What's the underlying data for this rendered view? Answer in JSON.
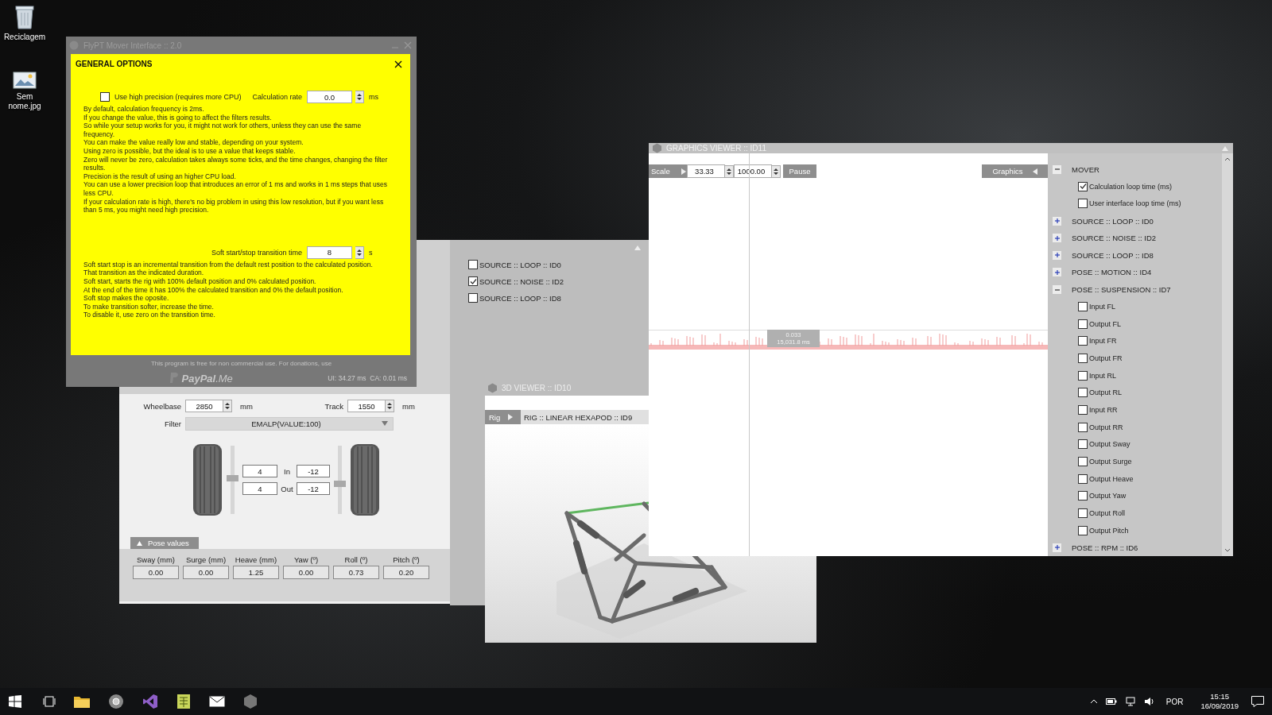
{
  "desktop_icons": [
    {
      "label": "Reciclagem",
      "kind": "recycle-bin"
    },
    {
      "label": "Sem nome.jpg",
      "kind": "image-file"
    }
  ],
  "suspension_window": {
    "wheelbase": {
      "label": "Wheelbase",
      "value": "2850",
      "unit": "mm"
    },
    "track": {
      "label": "Track",
      "value": "1550",
      "unit": "mm"
    },
    "filter": {
      "label": "Filter",
      "value": "EMALP(VALUE:100)"
    },
    "wheels": {
      "left_in": "4",
      "left_out": "4",
      "right_in": "-12",
      "right_out": "-12",
      "in_label": "In",
      "out_label": "Out",
      "left_slider": {
        "level": 0.52
      },
      "right_slider": {
        "level": 0.44
      }
    },
    "pose_tab": "Pose values",
    "pose_values": [
      {
        "label": "Sway (mm)",
        "value": "0.00"
      },
      {
        "label": "Surge (mm)",
        "value": "0.00"
      },
      {
        "label": "Heave (mm)",
        "value": "1.25"
      },
      {
        "label": "Yaw (º)",
        "value": "0.00"
      },
      {
        "label": "Roll (º)",
        "value": "0.73"
      },
      {
        "label": "Pitch (º)",
        "value": "0.20"
      }
    ]
  },
  "sources_panel": {
    "sources": [
      {
        "label": "SOURCE :: LOOP :: ID0",
        "checked": false
      },
      {
        "label": "SOURCE :: NOISE :: ID2",
        "checked": true
      },
      {
        "label": "SOURCE :: LOOP :: ID8",
        "checked": false
      }
    ]
  },
  "viewer_3d": {
    "title": "3D VIEWER :: ID10",
    "rig_label": "Rig",
    "rig_value": "RIG :: LINEAR HEXAPOD :: ID9"
  },
  "main_window": {
    "title": "FlyPT Mover Interface :: 2.0",
    "footer_note": "This program is free for non commercial use. For donations, use",
    "donation_link": "**PayPal**.Me",
    "timing": "UI: 34.27 ms  CA: 0.01 ms",
    "general_options": {
      "title": "GENERAL OPTIONS",
      "high_precision": {
        "label": "Use high precision (requires more CPU)",
        "checked": false
      },
      "calculation_rate": {
        "label": "Calculation rate",
        "value": "0.0",
        "unit": "ms"
      },
      "calculation_help": [
        "By default, calculation frequency is 2ms.",
        "If you change the value, this is going to affect the filters results.",
        "So while your setup works for you, it might not work for others, unless they can use the same frequency.",
        "You can make the value really low and stable, depending on your system.",
        "Using zero is possible, but the ideal is to use a value that keeps stable.",
        "Zero will never be zero, calculation takes always some ticks, and the time changes, changing the filter results.",
        "Precision is the result of using an higher CPU load.",
        "You can use a lower precision loop that introduces an error of 1 ms and works in 1 ms steps that uses less CPU.",
        "If your calculation rate is high, there's no big problem in using this low resolution, but if you want less than 5 ms, you might need high precision."
      ],
      "transition_time": {
        "label": "Soft start/stop transition time",
        "value": "8",
        "unit": "s"
      },
      "transition_help": [
        "Soft start stop is an incremental transition from the default rest position to the calculated position.",
        "That transition as the indicated duration.",
        "Soft start, starts the rig with 100% default position and 0% calculated position.",
        "At the end of the time it has 100% the calculated transition and 0% the default position.",
        "Soft stop makes the oposite.",
        "To make transition softer, increase the time.",
        "To disable it, use zero on the transition time."
      ]
    }
  },
  "graphics_viewer": {
    "title": "GRAPHICS VIEWER :: ID11",
    "scale_label": "Scale",
    "scale_min": "33.33",
    "scale_max": "1000.00",
    "pause": "Pause",
    "graphics_toggle": "Graphics",
    "cursor_readout": [
      "0.033",
      "15,031.8 ms"
    ],
    "tree": [
      {
        "label": "MOVER",
        "expanded": true,
        "children": [
          {
            "label": "Calculation loop time (ms)",
            "checked": true
          },
          {
            "label": "User interface loop time (ms)",
            "checked": false
          }
        ]
      },
      {
        "label": "SOURCE :: LOOP :: ID0",
        "expanded": false
      },
      {
        "label": "SOURCE :: NOISE :: ID2",
        "expanded": false
      },
      {
        "label": "SOURCE :: LOOP :: ID8",
        "expanded": false
      },
      {
        "label": "POSE :: MOTION :: ID4",
        "expanded": false
      },
      {
        "label": "POSE :: SUSPENSION :: ID7",
        "expanded": true,
        "children": [
          {
            "label": "Input FL",
            "checked": false
          },
          {
            "label": "Output FL",
            "checked": false
          },
          {
            "label": "Input FR",
            "checked": false
          },
          {
            "label": "Output FR",
            "checked": false
          },
          {
            "label": "Input RL",
            "checked": false
          },
          {
            "label": "Output RL",
            "checked": false
          },
          {
            "label": "Input RR",
            "checked": false
          },
          {
            "label": "Output RR",
            "checked": false
          },
          {
            "label": "Output Sway",
            "checked": false
          },
          {
            "label": "Output Surge",
            "checked": false
          },
          {
            "label": "Output Heave",
            "checked": false
          },
          {
            "label": "Output Yaw",
            "checked": false
          },
          {
            "label": "Output Roll",
            "checked": false
          },
          {
            "label": "Output Pitch",
            "checked": false
          }
        ]
      },
      {
        "label": "POSE :: RPM :: ID6",
        "expanded": false
      }
    ]
  },
  "taskbar": {
    "language": "POR",
    "time": "15:15",
    "date": "16/09/2019"
  }
}
